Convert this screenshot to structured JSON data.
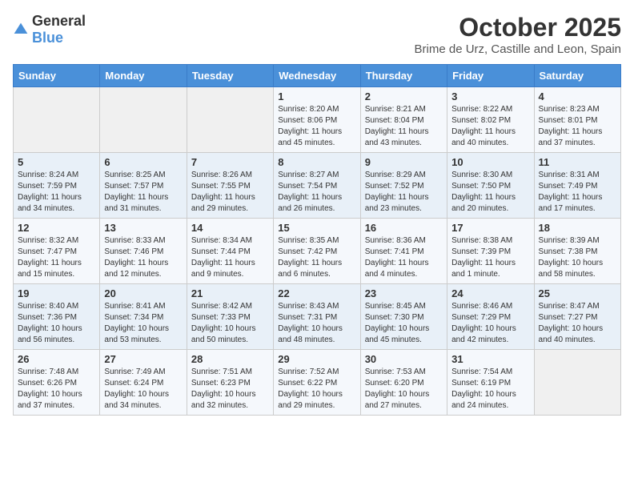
{
  "header": {
    "logo_general": "General",
    "logo_blue": "Blue",
    "title": "October 2025",
    "subtitle": "Brime de Urz, Castille and Leon, Spain"
  },
  "weekdays": [
    "Sunday",
    "Monday",
    "Tuesday",
    "Wednesday",
    "Thursday",
    "Friday",
    "Saturday"
  ],
  "weeks": [
    [
      {
        "day": "",
        "sunrise": "",
        "sunset": "",
        "daylight": ""
      },
      {
        "day": "",
        "sunrise": "",
        "sunset": "",
        "daylight": ""
      },
      {
        "day": "",
        "sunrise": "",
        "sunset": "",
        "daylight": ""
      },
      {
        "day": "1",
        "sunrise": "Sunrise: 8:20 AM",
        "sunset": "Sunset: 8:06 PM",
        "daylight": "Daylight: 11 hours and 45 minutes."
      },
      {
        "day": "2",
        "sunrise": "Sunrise: 8:21 AM",
        "sunset": "Sunset: 8:04 PM",
        "daylight": "Daylight: 11 hours and 43 minutes."
      },
      {
        "day": "3",
        "sunrise": "Sunrise: 8:22 AM",
        "sunset": "Sunset: 8:02 PM",
        "daylight": "Daylight: 11 hours and 40 minutes."
      },
      {
        "day": "4",
        "sunrise": "Sunrise: 8:23 AM",
        "sunset": "Sunset: 8:01 PM",
        "daylight": "Daylight: 11 hours and 37 minutes."
      }
    ],
    [
      {
        "day": "5",
        "sunrise": "Sunrise: 8:24 AM",
        "sunset": "Sunset: 7:59 PM",
        "daylight": "Daylight: 11 hours and 34 minutes."
      },
      {
        "day": "6",
        "sunrise": "Sunrise: 8:25 AM",
        "sunset": "Sunset: 7:57 PM",
        "daylight": "Daylight: 11 hours and 31 minutes."
      },
      {
        "day": "7",
        "sunrise": "Sunrise: 8:26 AM",
        "sunset": "Sunset: 7:55 PM",
        "daylight": "Daylight: 11 hours and 29 minutes."
      },
      {
        "day": "8",
        "sunrise": "Sunrise: 8:27 AM",
        "sunset": "Sunset: 7:54 PM",
        "daylight": "Daylight: 11 hours and 26 minutes."
      },
      {
        "day": "9",
        "sunrise": "Sunrise: 8:29 AM",
        "sunset": "Sunset: 7:52 PM",
        "daylight": "Daylight: 11 hours and 23 minutes."
      },
      {
        "day": "10",
        "sunrise": "Sunrise: 8:30 AM",
        "sunset": "Sunset: 7:50 PM",
        "daylight": "Daylight: 11 hours and 20 minutes."
      },
      {
        "day": "11",
        "sunrise": "Sunrise: 8:31 AM",
        "sunset": "Sunset: 7:49 PM",
        "daylight": "Daylight: 11 hours and 17 minutes."
      }
    ],
    [
      {
        "day": "12",
        "sunrise": "Sunrise: 8:32 AM",
        "sunset": "Sunset: 7:47 PM",
        "daylight": "Daylight: 11 hours and 15 minutes."
      },
      {
        "day": "13",
        "sunrise": "Sunrise: 8:33 AM",
        "sunset": "Sunset: 7:46 PM",
        "daylight": "Daylight: 11 hours and 12 minutes."
      },
      {
        "day": "14",
        "sunrise": "Sunrise: 8:34 AM",
        "sunset": "Sunset: 7:44 PM",
        "daylight": "Daylight: 11 hours and 9 minutes."
      },
      {
        "day": "15",
        "sunrise": "Sunrise: 8:35 AM",
        "sunset": "Sunset: 7:42 PM",
        "daylight": "Daylight: 11 hours and 6 minutes."
      },
      {
        "day": "16",
        "sunrise": "Sunrise: 8:36 AM",
        "sunset": "Sunset: 7:41 PM",
        "daylight": "Daylight: 11 hours and 4 minutes."
      },
      {
        "day": "17",
        "sunrise": "Sunrise: 8:38 AM",
        "sunset": "Sunset: 7:39 PM",
        "daylight": "Daylight: 11 hours and 1 minute."
      },
      {
        "day": "18",
        "sunrise": "Sunrise: 8:39 AM",
        "sunset": "Sunset: 7:38 PM",
        "daylight": "Daylight: 10 hours and 58 minutes."
      }
    ],
    [
      {
        "day": "19",
        "sunrise": "Sunrise: 8:40 AM",
        "sunset": "Sunset: 7:36 PM",
        "daylight": "Daylight: 10 hours and 56 minutes."
      },
      {
        "day": "20",
        "sunrise": "Sunrise: 8:41 AM",
        "sunset": "Sunset: 7:34 PM",
        "daylight": "Daylight: 10 hours and 53 minutes."
      },
      {
        "day": "21",
        "sunrise": "Sunrise: 8:42 AM",
        "sunset": "Sunset: 7:33 PM",
        "daylight": "Daylight: 10 hours and 50 minutes."
      },
      {
        "day": "22",
        "sunrise": "Sunrise: 8:43 AM",
        "sunset": "Sunset: 7:31 PM",
        "daylight": "Daylight: 10 hours and 48 minutes."
      },
      {
        "day": "23",
        "sunrise": "Sunrise: 8:45 AM",
        "sunset": "Sunset: 7:30 PM",
        "daylight": "Daylight: 10 hours and 45 minutes."
      },
      {
        "day": "24",
        "sunrise": "Sunrise: 8:46 AM",
        "sunset": "Sunset: 7:29 PM",
        "daylight": "Daylight: 10 hours and 42 minutes."
      },
      {
        "day": "25",
        "sunrise": "Sunrise: 8:47 AM",
        "sunset": "Sunset: 7:27 PM",
        "daylight": "Daylight: 10 hours and 40 minutes."
      }
    ],
    [
      {
        "day": "26",
        "sunrise": "Sunrise: 7:48 AM",
        "sunset": "Sunset: 6:26 PM",
        "daylight": "Daylight: 10 hours and 37 minutes."
      },
      {
        "day": "27",
        "sunrise": "Sunrise: 7:49 AM",
        "sunset": "Sunset: 6:24 PM",
        "daylight": "Daylight: 10 hours and 34 minutes."
      },
      {
        "day": "28",
        "sunrise": "Sunrise: 7:51 AM",
        "sunset": "Sunset: 6:23 PM",
        "daylight": "Daylight: 10 hours and 32 minutes."
      },
      {
        "day": "29",
        "sunrise": "Sunrise: 7:52 AM",
        "sunset": "Sunset: 6:22 PM",
        "daylight": "Daylight: 10 hours and 29 minutes."
      },
      {
        "day": "30",
        "sunrise": "Sunrise: 7:53 AM",
        "sunset": "Sunset: 6:20 PM",
        "daylight": "Daylight: 10 hours and 27 minutes."
      },
      {
        "day": "31",
        "sunrise": "Sunrise: 7:54 AM",
        "sunset": "Sunset: 6:19 PM",
        "daylight": "Daylight: 10 hours and 24 minutes."
      },
      {
        "day": "",
        "sunrise": "",
        "sunset": "",
        "daylight": ""
      }
    ]
  ]
}
